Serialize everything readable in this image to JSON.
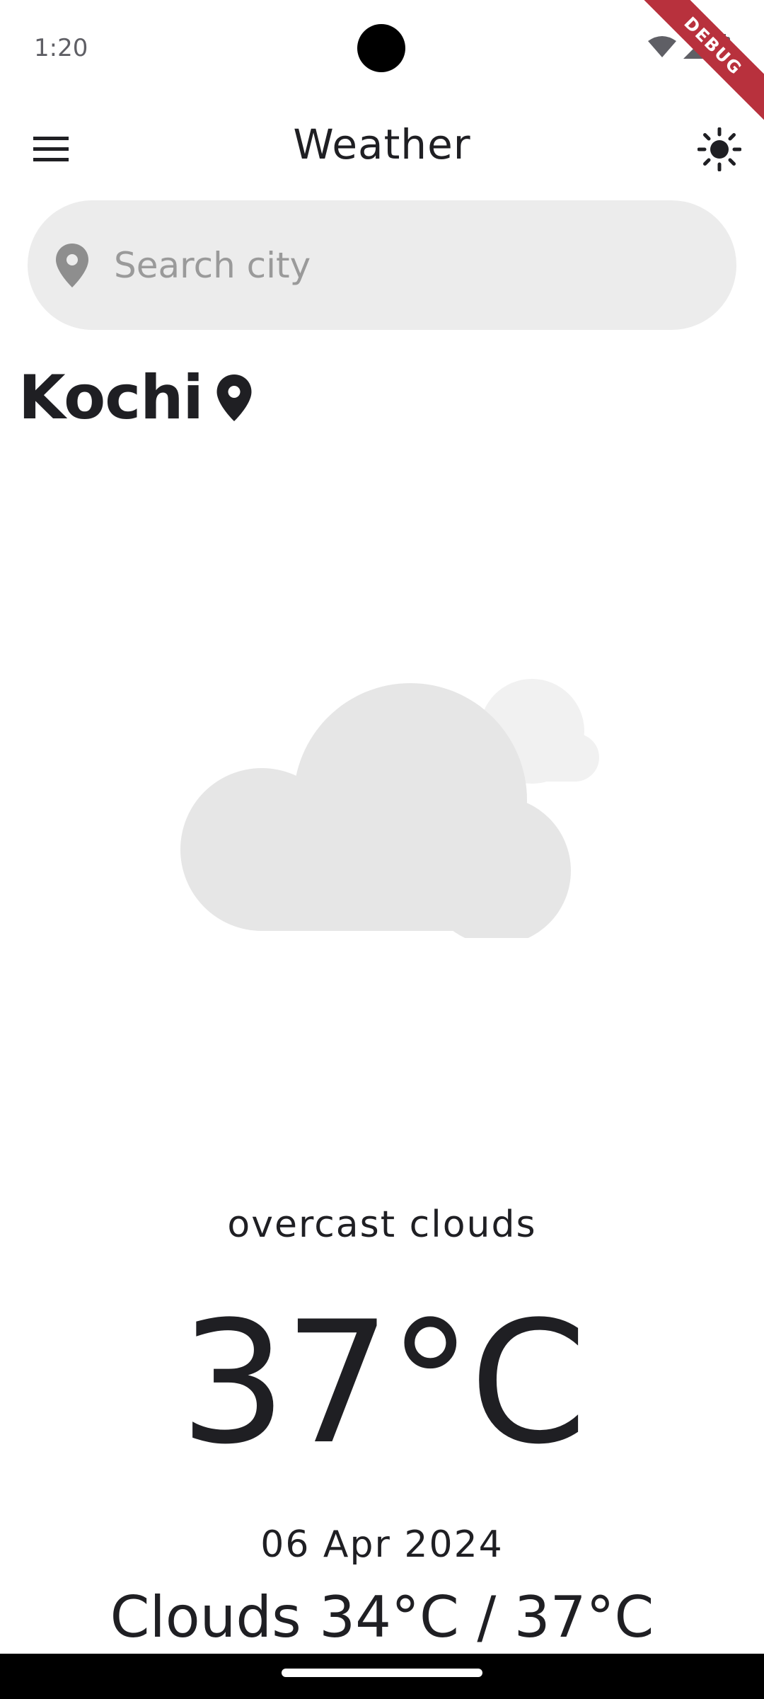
{
  "status_bar": {
    "time": "1:20",
    "icons": [
      "wifi-icon",
      "signal-icon",
      "battery-icon"
    ]
  },
  "debug_banner": {
    "label": "DEBUG",
    "color": "#b8313d"
  },
  "app_bar": {
    "title": "Weather",
    "menu_icon": "menu-icon",
    "theme_icon": "sun-icon"
  },
  "search": {
    "placeholder": "Search city",
    "value": "",
    "icon": "location-pin-icon"
  },
  "location": {
    "city": "Kochi",
    "icon": "location-pin-icon"
  },
  "weather": {
    "illustration": "cloud-icon",
    "description": "overcast clouds",
    "temperature": "37°C",
    "date": "06 Apr 2024",
    "summary": "Clouds 34°C / 37°C"
  },
  "colors": {
    "text": "#1f1f23",
    "search_bg": "#ececec",
    "cloud_main": "#e6e6e6",
    "cloud_back": "#f1f1f1"
  }
}
